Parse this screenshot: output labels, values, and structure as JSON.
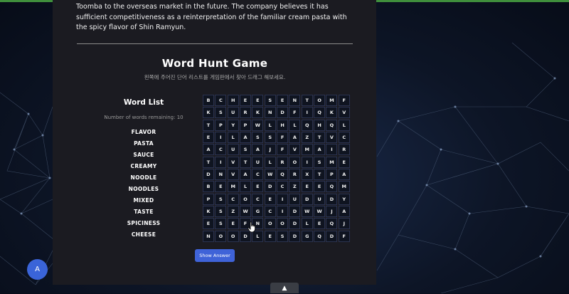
{
  "intro_text": "Toomba to the overseas market in the future.  The company believes it has sufficient competitiveness as a reinterpretation of the familiar cream pasta with the spicy flavor of Shin Ramyun.",
  "game": {
    "title": "Word Hunt Game",
    "subtitle": "왼쪽에 주어진 단어 리스트를 게임판에서 찾아 드래그 해보세요."
  },
  "word_list": {
    "title": "Word List",
    "remaining_label": "Number of words remaining:",
    "remaining_count": "10",
    "words": [
      "FLAVOR",
      "PASTA",
      "SAUCE",
      "CREAMY",
      "NOODLE",
      "NOODLES",
      "MIXED",
      "TASTE",
      "SPICINESS",
      "CHEESE"
    ]
  },
  "grid_rows": [
    [
      "B",
      "C",
      "H",
      "E",
      "E",
      "S",
      "E",
      "N",
      "T",
      "O",
      "M",
      "F"
    ],
    [
      "K",
      "S",
      "U",
      "R",
      "K",
      "N",
      "D",
      "F",
      "I",
      "Q",
      "K",
      "V"
    ],
    [
      "T",
      "P",
      "Y",
      "P",
      "W",
      "L",
      "H",
      "L",
      "Q",
      "H",
      "Q",
      "L"
    ],
    [
      "E",
      "I",
      "L",
      "A",
      "S",
      "S",
      "F",
      "A",
      "Z",
      "T",
      "V",
      "C"
    ],
    [
      "A",
      "C",
      "U",
      "S",
      "A",
      "J",
      "F",
      "V",
      "M",
      "A",
      "I",
      "R"
    ],
    [
      "T",
      "I",
      "V",
      "T",
      "U",
      "L",
      "R",
      "O",
      "I",
      "S",
      "M",
      "E"
    ],
    [
      "D",
      "N",
      "V",
      "A",
      "C",
      "W",
      "Q",
      "R",
      "X",
      "T",
      "P",
      "A"
    ],
    [
      "B",
      "E",
      "M",
      "L",
      "E",
      "D",
      "C",
      "Z",
      "E",
      "E",
      "Q",
      "M"
    ],
    [
      "P",
      "S",
      "C",
      "O",
      "C",
      "E",
      "I",
      "U",
      "D",
      "U",
      "D",
      "Y"
    ],
    [
      "K",
      "S",
      "Z",
      "W",
      "G",
      "C",
      "I",
      "D",
      "W",
      "W",
      "J",
      "A"
    ],
    [
      "E",
      "S",
      "E",
      "F",
      "N",
      "O",
      "O",
      "D",
      "L",
      "E",
      "Q",
      "J"
    ],
    [
      "N",
      "O",
      "O",
      "D",
      "L",
      "E",
      "S",
      "D",
      "G",
      "Q",
      "D",
      "F"
    ]
  ],
  "show_answer_label": "Show Answer",
  "avatar_letter": "A",
  "scroll_top_glyph": "▲",
  "icons": {
    "scroll_top": "chevron-up-icon",
    "cursor": "hand-cursor-icon"
  },
  "colors": {
    "accent": "#3f63d8",
    "panel": "#1b1b21",
    "cell_bg": "#0f1420"
  }
}
